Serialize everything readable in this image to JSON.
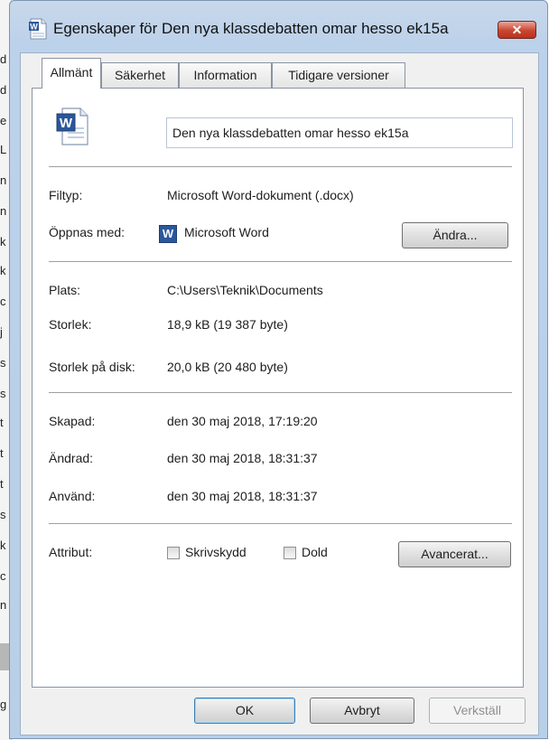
{
  "background_window": {
    "edge_letters": [
      "d",
      "d",
      "e",
      "L",
      "n",
      "n",
      "k",
      "k",
      "c",
      "j",
      "s",
      "s",
      "t",
      "t",
      "t",
      "s",
      "k",
      "c",
      "n",
      "g"
    ]
  },
  "dialog": {
    "title": "Egenskaper för Den nya klassdebatten omar hesso ek15a",
    "close_glyph": "✕",
    "tabs": [
      {
        "label": "Allmänt",
        "active": true
      },
      {
        "label": "Säkerhet",
        "active": false
      },
      {
        "label": "Information",
        "active": false
      },
      {
        "label": "Tidigare versioner",
        "active": false
      }
    ],
    "file_name": "Den nya klassdebatten omar hesso ek15a",
    "file_type": {
      "label": "Filtyp:",
      "value": "Microsoft Word-dokument (.docx)"
    },
    "opens_with": {
      "label": "Öppnas med:",
      "app_icon_letter": "W",
      "value": "Microsoft Word",
      "change_button": "Ändra..."
    },
    "location": {
      "label": "Plats:",
      "value": "C:\\Users\\Teknik\\Documents"
    },
    "size": {
      "label": "Storlek:",
      "value": "18,9 kB (19 387 byte)"
    },
    "size_on_disk": {
      "label": "Storlek på disk:",
      "value": "20,0 kB (20 480 byte)"
    },
    "created": {
      "label": "Skapad:",
      "value": "den 30 maj 2018, 17:19:20"
    },
    "modified": {
      "label": "Ändrad:",
      "value": "den 30 maj 2018, 18:31:37"
    },
    "accessed": {
      "label": "Använd:",
      "value": "den 30 maj 2018, 18:31:37"
    },
    "attributes": {
      "label": "Attribut:",
      "read_only": {
        "label": "Skrivskydd",
        "checked": false
      },
      "hidden": {
        "label": "Dold",
        "checked": false
      },
      "advanced_button": "Avancerat..."
    },
    "buttons": {
      "ok": "OK",
      "cancel": "Avbryt",
      "apply": "Verkställ",
      "apply_enabled": false
    }
  },
  "colors": {
    "word_blue": "#2b579a",
    "close_red": "#c9462f",
    "frame_blue": "#bcd1ea"
  }
}
